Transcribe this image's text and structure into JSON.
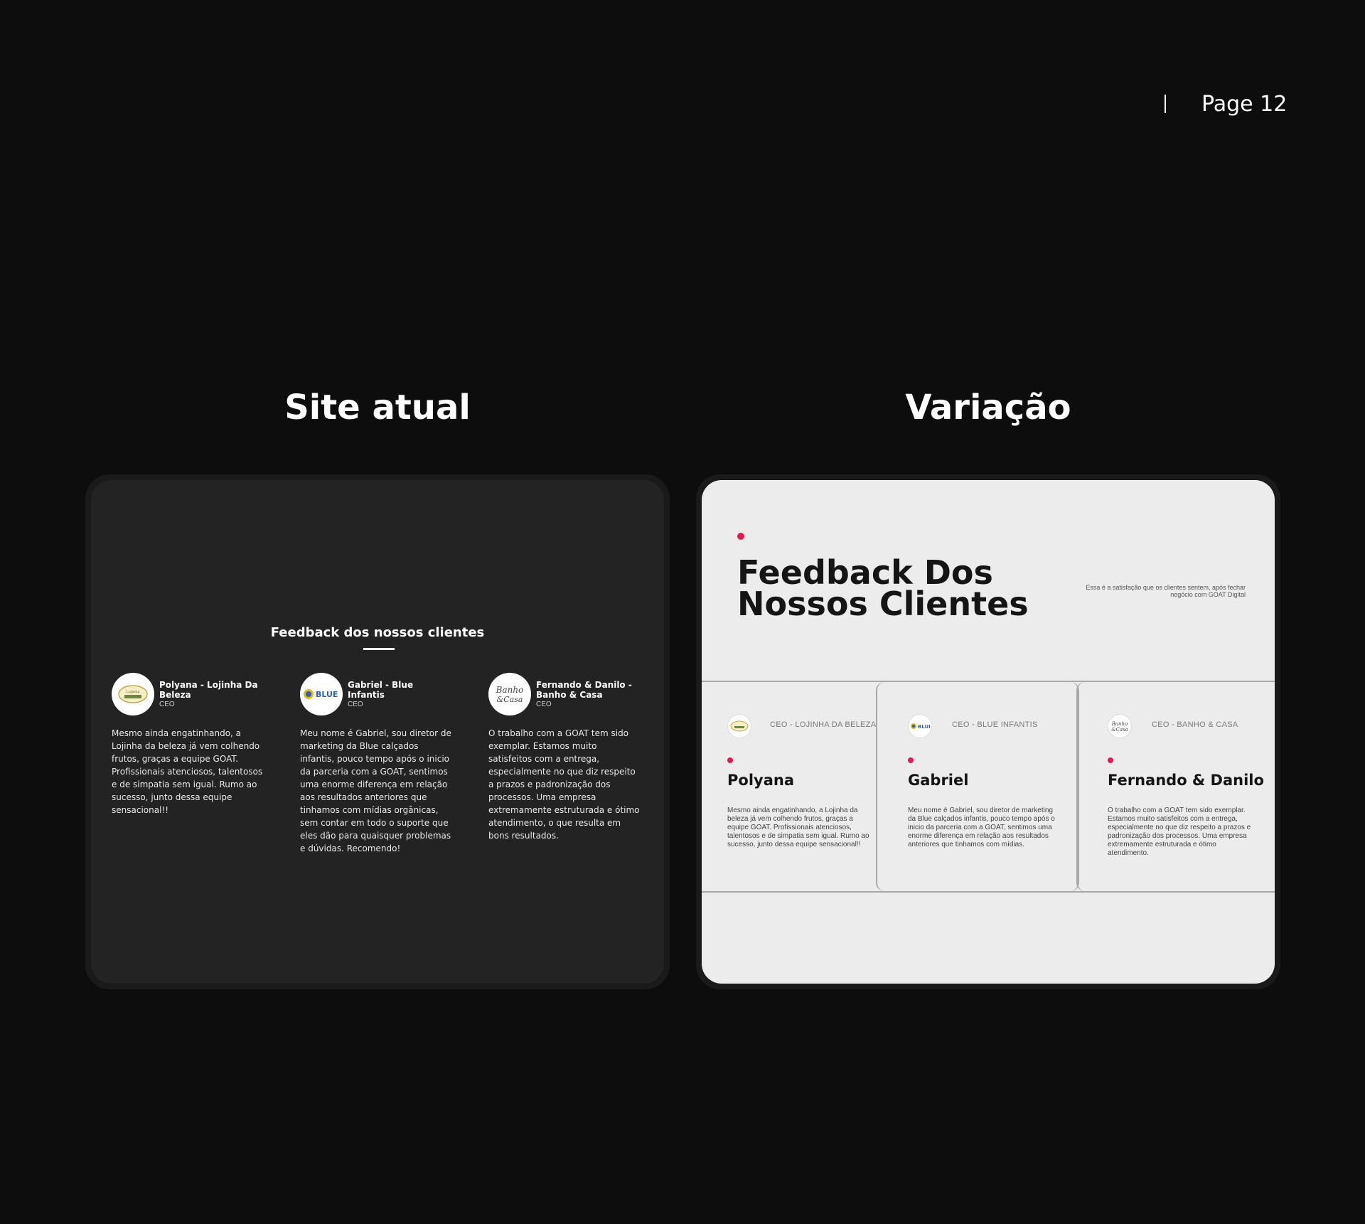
{
  "page": {
    "label": "Page 12"
  },
  "columns": {
    "left_title": "Site atual",
    "right_title": "Variação"
  },
  "current_site": {
    "heading": "Feedback dos nossos clientes",
    "testimonials": [
      {
        "name": "Polyana - Lojinha Da Beleza",
        "role": "CEO",
        "logo": "Lojinha da Beleza",
        "text": "Mesmo ainda engatinhando, a Lojinha da beleza já vem colhendo frutos, graças a equipe GOAT. Profissionais atenciosos, talentosos e de simpatia sem igual. Rumo ao sucesso, junto dessa equipe sensacional!!"
      },
      {
        "name": "Gabriel - Blue Infantis",
        "role": "CEO",
        "logo": "BLUE",
        "text": "Meu nome é Gabriel, sou diretor de marketing da Blue calçados infantis, pouco tempo após o inicio da parceria com a GOAT, sentimos uma enorme diferença em relação aos resultados anteriores que tinhamos com mídias orgânicas, sem contar em todo o suporte que eles dão para quaisquer problemas e dúvidas. Recomendo!"
      },
      {
        "name": "Fernando & Danilo - Banho & Casa",
        "role": "CEO",
        "logo": "Banho & Casa",
        "text": "O trabalho com a GOAT tem sido exemplar. Estamos muito satisfeitos com a entrega, especialmente no que diz respeito a prazos e padronização dos processos. Uma empresa extremamente estruturada e ótimo atendimento, o que resulta em bons resultados."
      }
    ]
  },
  "variation": {
    "heading_line1": "Feedback Dos",
    "heading_line2": "Nossos Clientes",
    "subtitle": "Essa é a satisfação que os clientes sentem, após fechar negócio com GOAT Digital",
    "accent_color": "#e6194e",
    "testimonials": [
      {
        "role": "CEO - LOJINHA DA BELEZA",
        "name": "Polyana",
        "text": "Mesmo ainda engatinhando, a Lojinha da beleza já vem colhendo frutos, graças a equipe GOAT. Profissionais atenciosos, talentosos e de simpatia sem igual. Rumo ao sucesso, junto dessa equipe sensacional!!"
      },
      {
        "role": "CEO - BLUE INFANTIS",
        "name": "Gabriel",
        "text": "Meu nome é Gabriel, sou diretor de marketing da Blue calçados infantis, pouco tempo após o inicio da parceria com a GOAT, sentimos uma enorme diferença em relação aos resultados anteriores que tinhamos com mídias."
      },
      {
        "role": "CEO - BANHO & CASA",
        "name": "Fernando & Danilo",
        "text": "O trabalho com a GOAT tem sido exemplar. Estamos muito satisfeitos com a entrega, especialmente no que diz respeito a prazos e padronização dos processos. Uma empresa extremamente estruturada e ótimo atendimento."
      }
    ]
  }
}
